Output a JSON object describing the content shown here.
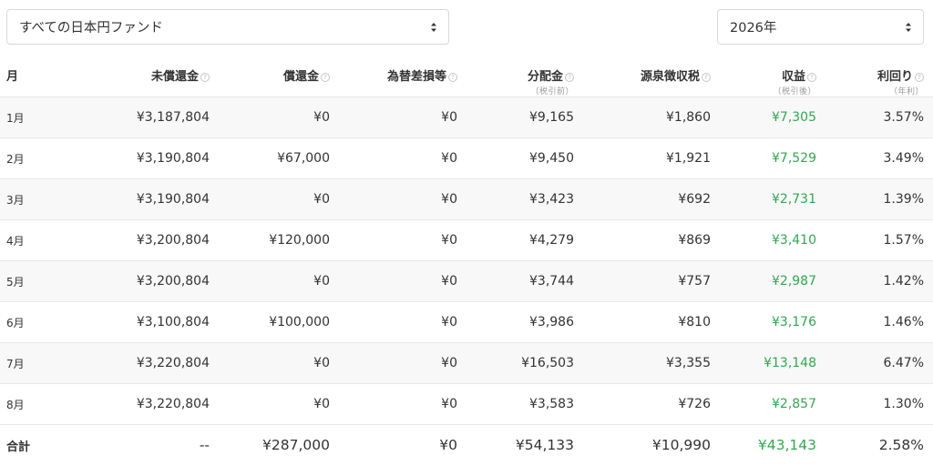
{
  "selects": {
    "fund": {
      "value": "すべての日本円ファンド"
    },
    "year": {
      "value": "2026年"
    }
  },
  "columns": [
    {
      "label": "月",
      "sub": "",
      "info": false
    },
    {
      "label": "未償還金",
      "sub": "",
      "info": true
    },
    {
      "label": "償還金",
      "sub": "",
      "info": true
    },
    {
      "label": "為替差損等",
      "sub": "",
      "info": true
    },
    {
      "label": "分配金",
      "sub": "（税引前）",
      "info": true
    },
    {
      "label": "源泉徴収税",
      "sub": "",
      "info": true
    },
    {
      "label": "収益",
      "sub": "（税引後）",
      "info": true
    },
    {
      "label": "利回り",
      "sub": "（年利）",
      "info": true
    }
  ],
  "rows": [
    [
      "1月",
      "¥3,187,804",
      "¥0",
      "¥0",
      "¥9,165",
      "¥1,860",
      "¥7,305",
      "3.57%"
    ],
    [
      "2月",
      "¥3,190,804",
      "¥67,000",
      "¥0",
      "¥9,450",
      "¥1,921",
      "¥7,529",
      "3.49%"
    ],
    [
      "3月",
      "¥3,190,804",
      "¥0",
      "¥0",
      "¥3,423",
      "¥692",
      "¥2,731",
      "1.39%"
    ],
    [
      "4月",
      "¥3,200,804",
      "¥120,000",
      "¥0",
      "¥4,279",
      "¥869",
      "¥3,410",
      "1.57%"
    ],
    [
      "5月",
      "¥3,200,804",
      "¥0",
      "¥0",
      "¥3,744",
      "¥757",
      "¥2,987",
      "1.42%"
    ],
    [
      "6月",
      "¥3,100,804",
      "¥100,000",
      "¥0",
      "¥3,986",
      "¥810",
      "¥3,176",
      "1.46%"
    ],
    [
      "7月",
      "¥3,220,804",
      "¥0",
      "¥0",
      "¥16,503",
      "¥3,355",
      "¥13,148",
      "6.47%"
    ],
    [
      "8月",
      "¥3,220,804",
      "¥0",
      "¥0",
      "¥3,583",
      "¥726",
      "¥2,857",
      "1.30%"
    ]
  ],
  "total": [
    "合計",
    "--",
    "¥287,000",
    "¥0",
    "¥54,133",
    "¥10,990",
    "¥43,143",
    "2.58%"
  ],
  "info_icon_glyph": "?",
  "colors": {
    "positive": "#2eaa4f",
    "text": "#333333",
    "row_alt": "#f8f8f8"
  }
}
